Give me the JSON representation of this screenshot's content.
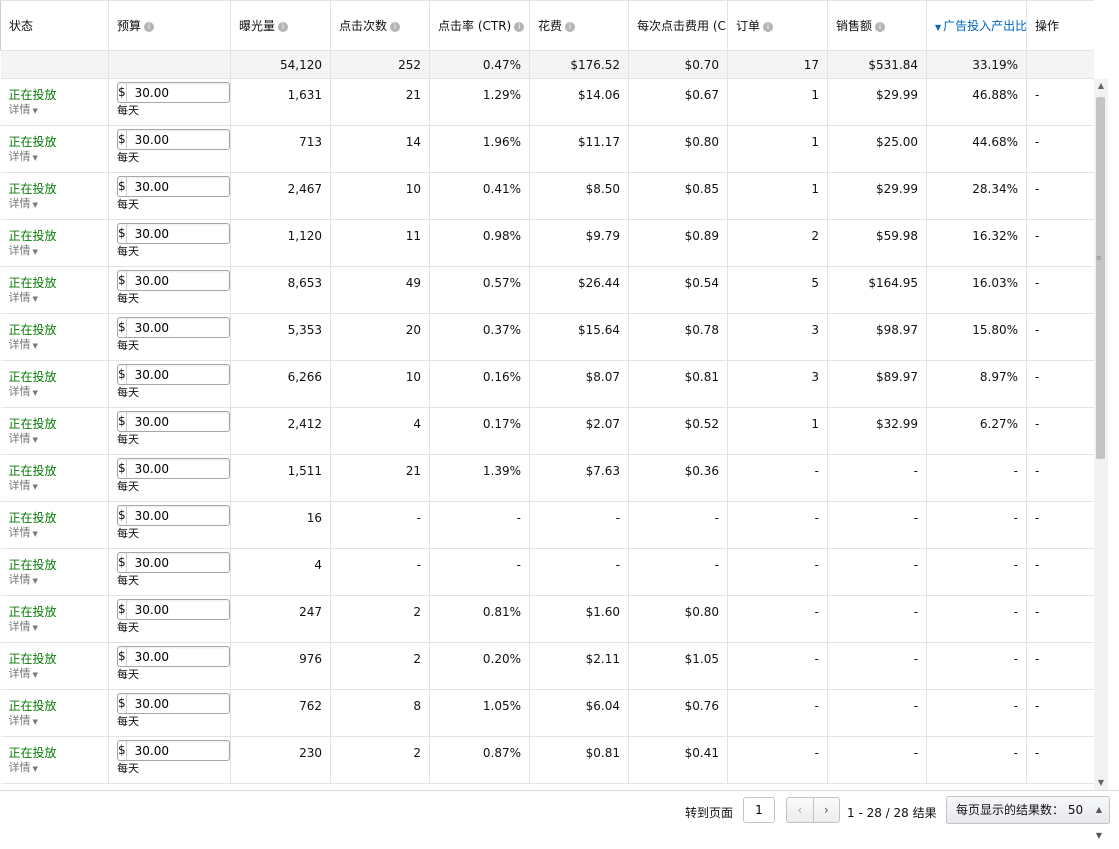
{
  "columns": [
    {
      "label": "状态",
      "info": false,
      "sorted": false
    },
    {
      "label": "预算",
      "info": true,
      "sorted": false
    },
    {
      "label": "曝光量",
      "info": true,
      "sorted": false
    },
    {
      "label": "点击次数",
      "info": true,
      "sorted": false
    },
    {
      "label": "点击率 (CTR)",
      "info": true,
      "sorted": false
    },
    {
      "label": "花费",
      "info": true,
      "sorted": false
    },
    {
      "label": "每次点击费用 (CPC)",
      "info": true,
      "sorted": false
    },
    {
      "label": "订单",
      "info": true,
      "sorted": false
    },
    {
      "label": "销售额",
      "info": true,
      "sorted": false
    },
    {
      "label": "广告投入产出比",
      "info": true,
      "sorted": true
    },
    {
      "label": "操作",
      "info": false,
      "sorted": false
    }
  ],
  "totals": [
    "",
    "",
    "54,120",
    "252",
    "0.47%",
    "$176.52",
    "$0.70",
    "17",
    "$531.84",
    "33.19%",
    ""
  ],
  "status_color": "#067d06",
  "sort_color": "#0066c0",
  "budget": {
    "currency": "$",
    "period": "每天"
  },
  "rows": [
    {
      "status": "正在投放",
      "details": "详情",
      "budget": "30.00",
      "impressions": "1,631",
      "clicks": "21",
      "ctr": "1.29%",
      "spend": "$14.06",
      "cpc": "$0.67",
      "orders": "1",
      "sales": "$29.99",
      "acos": "46.88%",
      "action": "-"
    },
    {
      "status": "正在投放",
      "details": "详情",
      "budget": "30.00",
      "impressions": "713",
      "clicks": "14",
      "ctr": "1.96%",
      "spend": "$11.17",
      "cpc": "$0.80",
      "orders": "1",
      "sales": "$25.00",
      "acos": "44.68%",
      "action": "-"
    },
    {
      "status": "正在投放",
      "details": "详情",
      "budget": "30.00",
      "impressions": "2,467",
      "clicks": "10",
      "ctr": "0.41%",
      "spend": "$8.50",
      "cpc": "$0.85",
      "orders": "1",
      "sales": "$29.99",
      "acos": "28.34%",
      "action": "-"
    },
    {
      "status": "正在投放",
      "details": "详情",
      "budget": "30.00",
      "impressions": "1,120",
      "clicks": "11",
      "ctr": "0.98%",
      "spend": "$9.79",
      "cpc": "$0.89",
      "orders": "2",
      "sales": "$59.98",
      "acos": "16.32%",
      "action": "-"
    },
    {
      "status": "正在投放",
      "details": "详情",
      "budget": "30.00",
      "impressions": "8,653",
      "clicks": "49",
      "ctr": "0.57%",
      "spend": "$26.44",
      "cpc": "$0.54",
      "orders": "5",
      "sales": "$164.95",
      "acos": "16.03%",
      "action": "-"
    },
    {
      "status": "正在投放",
      "details": "详情",
      "budget": "30.00",
      "impressions": "5,353",
      "clicks": "20",
      "ctr": "0.37%",
      "spend": "$15.64",
      "cpc": "$0.78",
      "orders": "3",
      "sales": "$98.97",
      "acos": "15.80%",
      "action": "-"
    },
    {
      "status": "正在投放",
      "details": "详情",
      "budget": "30.00",
      "impressions": "6,266",
      "clicks": "10",
      "ctr": "0.16%",
      "spend": "$8.07",
      "cpc": "$0.81",
      "orders": "3",
      "sales": "$89.97",
      "acos": "8.97%",
      "action": "-"
    },
    {
      "status": "正在投放",
      "details": "详情",
      "budget": "30.00",
      "impressions": "2,412",
      "clicks": "4",
      "ctr": "0.17%",
      "spend": "$2.07",
      "cpc": "$0.52",
      "orders": "1",
      "sales": "$32.99",
      "acos": "6.27%",
      "action": "-"
    },
    {
      "status": "正在投放",
      "details": "详情",
      "budget": "30.00",
      "impressions": "1,511",
      "clicks": "21",
      "ctr": "1.39%",
      "spend": "$7.63",
      "cpc": "$0.36",
      "orders": "-",
      "sales": "-",
      "acos": "-",
      "action": "-"
    },
    {
      "status": "正在投放",
      "details": "详情",
      "budget": "30.00",
      "impressions": "16",
      "clicks": "-",
      "ctr": "-",
      "spend": "-",
      "cpc": "-",
      "orders": "-",
      "sales": "-",
      "acos": "-",
      "action": "-"
    },
    {
      "status": "正在投放",
      "details": "详情",
      "budget": "30.00",
      "impressions": "4",
      "clicks": "-",
      "ctr": "-",
      "spend": "-",
      "cpc": "-",
      "orders": "-",
      "sales": "-",
      "acos": "-",
      "action": "-"
    },
    {
      "status": "正在投放",
      "details": "详情",
      "budget": "30.00",
      "impressions": "247",
      "clicks": "2",
      "ctr": "0.81%",
      "spend": "$1.60",
      "cpc": "$0.80",
      "orders": "-",
      "sales": "-",
      "acos": "-",
      "action": "-"
    },
    {
      "status": "正在投放",
      "details": "详情",
      "budget": "30.00",
      "impressions": "976",
      "clicks": "2",
      "ctr": "0.20%",
      "spend": "$2.11",
      "cpc": "$1.05",
      "orders": "-",
      "sales": "-",
      "acos": "-",
      "action": "-"
    },
    {
      "status": "正在投放",
      "details": "详情",
      "budget": "30.00",
      "impressions": "762",
      "clicks": "8",
      "ctr": "1.05%",
      "spend": "$6.04",
      "cpc": "$0.76",
      "orders": "-",
      "sales": "-",
      "acos": "-",
      "action": "-"
    },
    {
      "status": "正在投放",
      "details": "详情",
      "budget": "30.00",
      "impressions": "230",
      "clicks": "2",
      "ctr": "0.87%",
      "spend": "$0.81",
      "cpc": "$0.41",
      "orders": "-",
      "sales": "-",
      "acos": "-",
      "action": "-"
    }
  ],
  "footer": {
    "goto_label": "转到页面",
    "page": "1",
    "range": "1 - 28 / 28 结果",
    "per_page_label": "每页显示的结果数：",
    "per_page": "50"
  }
}
